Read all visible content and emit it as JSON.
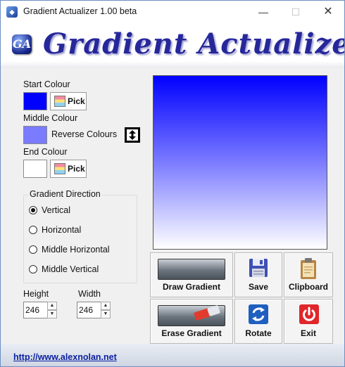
{
  "window": {
    "title": "Gradient Actualizer 1.00 beta",
    "minimize": "—",
    "maximize": "☐",
    "close": "✕"
  },
  "banner": {
    "logo_letters": "GA",
    "title": "Gradient Actualizer"
  },
  "colours": {
    "start": {
      "label": "Start Colour",
      "value": "#0000ff",
      "pick_label": "Pick"
    },
    "middle": {
      "label": "Middle Colour",
      "value": "#7b7bff"
    },
    "end": {
      "label": "End Colour",
      "value": "#ffffff",
      "pick_label": "Pick"
    },
    "reverse_label": "Reverse Colours"
  },
  "direction": {
    "title": "Gradient Direction",
    "options": [
      {
        "label": "Vertical",
        "selected": true
      },
      {
        "label": "Horizontal",
        "selected": false
      },
      {
        "label": "Middle Horizontal",
        "selected": false
      },
      {
        "label": "Middle Vertical",
        "selected": false
      }
    ]
  },
  "size": {
    "height_label": "Height",
    "height_value": "246",
    "width_label": "Width",
    "width_value": "246"
  },
  "buttons": {
    "draw": "Draw Gradient",
    "save": "Save",
    "clipboard": "Clipboard",
    "erase": "Erase Gradient",
    "rotate": "Rotate",
    "exit": "Exit"
  },
  "footer": {
    "url": "http://www.alexnolan.net"
  }
}
